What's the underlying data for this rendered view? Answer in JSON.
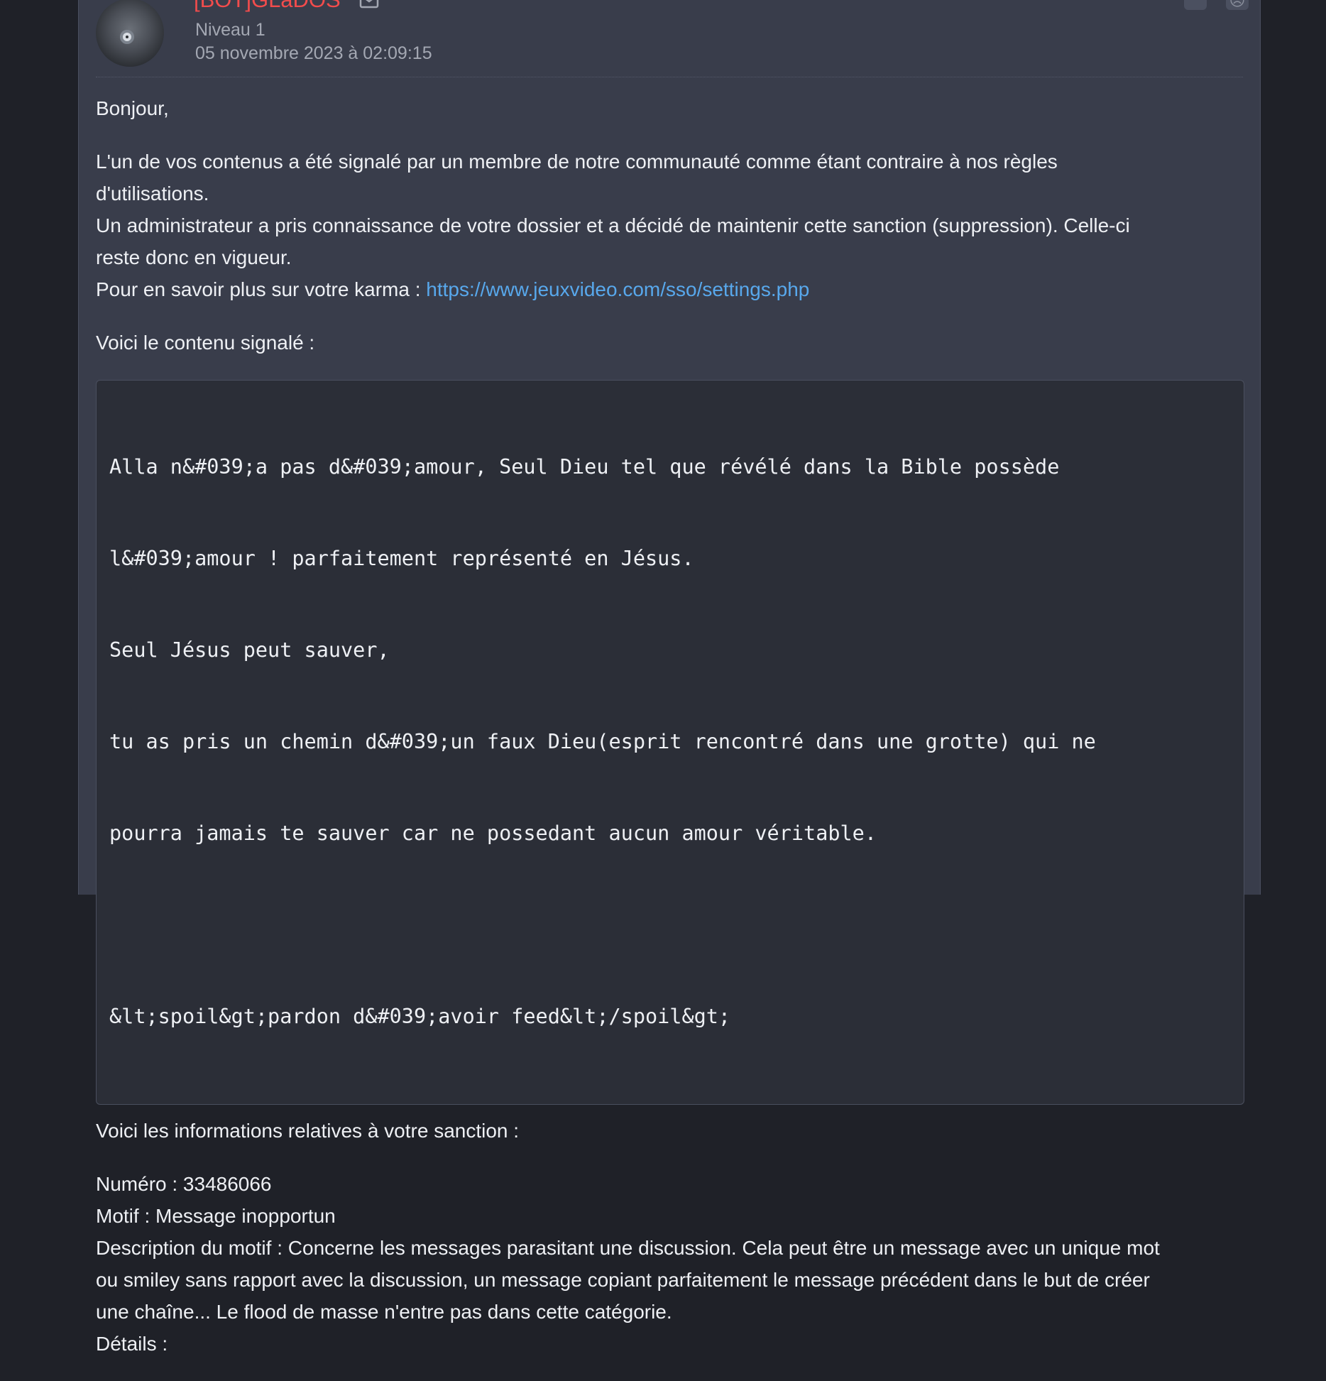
{
  "author": {
    "name": "[BOT]GLaDOS",
    "level": "Niveau 1",
    "date": "05 novembre 2023 à 02:09:15"
  },
  "actions": {
    "quote_icon": "quote-icon",
    "report_icon": "report-icon"
  },
  "message": {
    "greeting": "Bonjour,",
    "para1_line1": "L'un de vos contenus a été signalé par un membre de notre communauté comme étant contraire à nos règles",
    "para1_line2": "d'utilisations.",
    "para1_line3": "Un administrateur a pris connaissance de votre dossier et a décidé de maintenir cette sanction (suppression). Celle-ci",
    "para1_line4": "reste donc en vigueur.",
    "karma_prefix": "Pour en savoir plus sur votre karma : ",
    "karma_link": "https://www.jeuxvideo.com/sso/settings.php",
    "reported_intro": "Voici le contenu signalé :",
    "reported_content": [
      "Alla n&#039;a pas d&#039;amour, Seul Dieu tel que révélé dans la Bible possède",
      "l&#039;amour ! parfaitement représenté en Jésus.",
      "Seul Jésus peut sauver,",
      "tu as pris un chemin d&#039;un faux Dieu(esprit rencontré dans une grotte) qui ne",
      "pourra jamais te sauver car ne possedant aucun amour véritable.",
      "",
      "&lt;spoil&gt;pardon d&#039;avoir feed&lt;/spoil&gt;"
    ],
    "sanction_intro": "Voici les informations relatives à votre sanction :",
    "numero": "Numéro : 33486066",
    "motif": "Motif : Message inopportun",
    "description_line1": "Description du motif : Concerne les messages parasitant une discussion. Cela peut être un message avec un unique mot",
    "description_line2": "ou smiley sans rapport avec la discussion, un message copiant parfaitement le message précédent dans le but de créer",
    "description_line3": "une chaîne... Le flood de masse n'entre pas dans cette catégorie.",
    "details_partial": "Détails :"
  },
  "colors": {
    "page_bg": "#1f2128",
    "card_bg": "#393d4b",
    "author_name": "#f24c4c",
    "link": "#58a8ec",
    "code_bg": "#2b2e37"
  }
}
